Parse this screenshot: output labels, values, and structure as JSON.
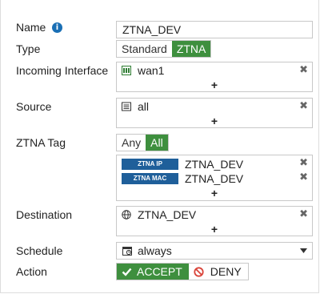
{
  "form": {
    "name": {
      "label": "Name",
      "value": "ZTNA_DEV"
    },
    "type": {
      "label": "Type",
      "options": [
        "Standard",
        "ZTNA"
      ],
      "selected": "ZTNA"
    },
    "incoming_interface": {
      "label": "Incoming Interface",
      "items": [
        "wan1"
      ],
      "add": "+"
    },
    "source": {
      "label": "Source",
      "items": [
        "all"
      ],
      "add": "+"
    },
    "ztna_tag": {
      "label": "ZTNA Tag",
      "toggle": [
        "Any",
        "All"
      ],
      "selected": "All",
      "items": [
        {
          "badge": "ZTNA IP",
          "value": "ZTNA_DEV"
        },
        {
          "badge": "ZTNA MAC",
          "value": "ZTNA_DEV"
        }
      ],
      "add": "+"
    },
    "destination": {
      "label": "Destination",
      "items": [
        "ZTNA_DEV"
      ],
      "add": "+"
    },
    "schedule": {
      "label": "Schedule",
      "value": "always"
    },
    "action": {
      "label": "Action",
      "accept": "ACCEPT",
      "deny": "DENY",
      "selected": "ACCEPT"
    }
  },
  "colors": {
    "accent_green": "#3e8f3e",
    "badge_blue": "#1f5f9a",
    "info_blue": "#1a6fb5",
    "deny_red": "#d9443a"
  },
  "icons": {
    "info": "info-icon",
    "remove": "close-icon",
    "interface": "port-icon",
    "address": "address-list-icon",
    "web": "globe-icon",
    "schedule": "calendar-icon",
    "accept": "check-icon",
    "deny": "deny-icon"
  }
}
